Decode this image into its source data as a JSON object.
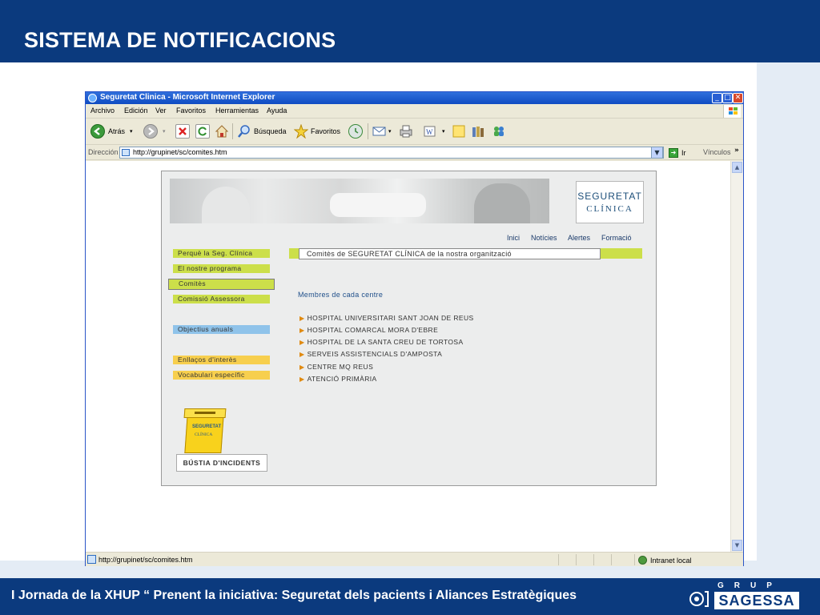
{
  "slide": {
    "title": "SISTEMA DE NOTIFICACIONS",
    "footer": "I Jornada de la XHUP “ Prenent la iniciativa: Seguretat dels pacients i Aliances Estratègiques",
    "logo_grup": "GRUP",
    "logo_sagessa": "SAGESSA",
    "colors": {
      "header": "#0b3a7e",
      "side_band": "#e4ecf5"
    }
  },
  "browser": {
    "title": "Seguretat Clinica - Microsoft Internet Explorer",
    "menu": [
      "Archivo",
      "Edición",
      "Ver",
      "Favoritos",
      "Herramientas",
      "Ayuda"
    ],
    "toolbar": {
      "back": "Atrás",
      "search": "Búsqueda",
      "favorites": "Favoritos"
    },
    "address_label": "Dirección",
    "address": "http://grupinet/sc/comites.htm",
    "go": "Ir",
    "links": "Vínculos",
    "status_url": "http://grupinet/sc/comites.htm",
    "status_zone": "Intranet local"
  },
  "site": {
    "brand_line1": "SEGURETAT",
    "brand_line2": "CLÍNICA",
    "top_nav": [
      "Inici",
      "Notícies",
      "Alertes",
      "Formació"
    ],
    "left_nav": [
      {
        "label": "Perquè la Seg. Clínica",
        "color": "#ccdf4a"
      },
      {
        "label": "El nostre programa",
        "color": "#ccdf4a"
      },
      {
        "label": "Comitès",
        "color": "#ccdf4a"
      },
      {
        "label": "Comissió Assessora",
        "color": "#ccdf4a"
      },
      {
        "label": "Objectius anuals",
        "color": "#8fc3ea"
      },
      {
        "label": "Enllaços d'interès",
        "color": "#f7cf4e"
      },
      {
        "label": "Vocabulari específic",
        "color": "#f7cf4e"
      }
    ],
    "section_title": "Comitès de SEGURETAT CLÍNICA de la nostra organització",
    "members_heading": "Membres de cada centre",
    "hospitals": [
      "HOSPITAL UNIVERSITARI SANT JOAN DE REUS",
      "HOSPITAL COMARCAL MORA D'EBRE",
      "HOSPITAL DE LA SANTA CREU DE TORTOSA",
      "SERVEIS ASSISTENCIALS D'AMPOSTA",
      "CENTRE MQ REUS",
      "ATENCIÓ PRIMÀRIA"
    ],
    "mailbox_line1": "SEGURETAT",
    "mailbox_line2": "CLÍNICA",
    "mailbox_label": "BÚSTIA D'INCIDENTS"
  }
}
